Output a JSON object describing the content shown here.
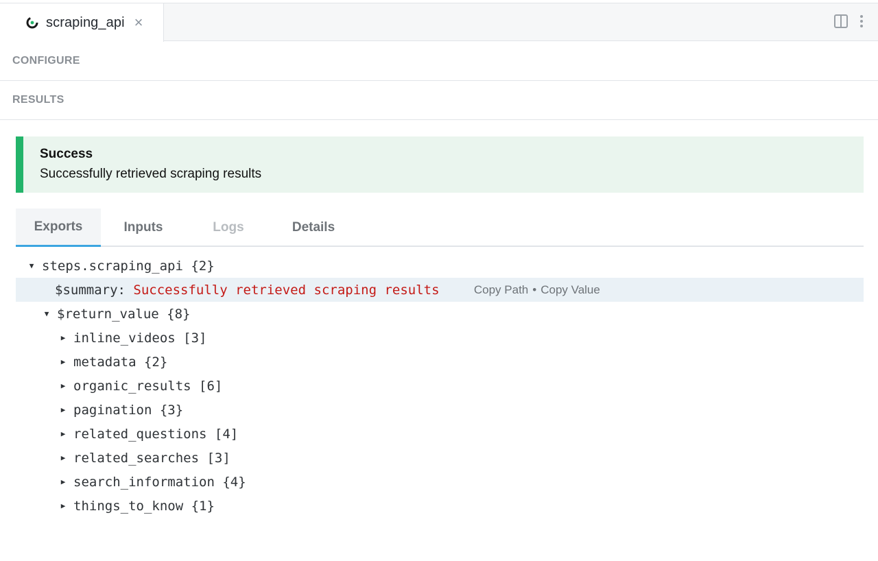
{
  "tab": {
    "title": "scraping_api",
    "close": "×"
  },
  "sections": {
    "configure": "CONFIGURE",
    "results": "RESULTS"
  },
  "alert": {
    "title": "Success",
    "message": "Successfully retrieved scraping results",
    "accent": "#23b46a"
  },
  "inner_tabs": [
    {
      "label": "Exports",
      "state": "active"
    },
    {
      "label": "Inputs",
      "state": "normal"
    },
    {
      "label": "Logs",
      "state": "disabled"
    },
    {
      "label": "Details",
      "state": "normal"
    }
  ],
  "tree": {
    "root": {
      "label": "steps.scraping_api",
      "count": "{2}"
    },
    "summary": {
      "key": "$summary:",
      "value": "Successfully retrieved scraping results",
      "copy_path": "Copy Path",
      "separator": "•",
      "copy_value": "Copy Value"
    },
    "return_value": {
      "label": "$return_value",
      "count": "{8}"
    },
    "children": [
      {
        "label": "inline_videos",
        "count": "[3]"
      },
      {
        "label": "metadata",
        "count": "{2}"
      },
      {
        "label": "organic_results",
        "count": "[6]"
      },
      {
        "label": "pagination",
        "count": "{3}"
      },
      {
        "label": "related_questions",
        "count": "[4]"
      },
      {
        "label": "related_searches",
        "count": "[3]"
      },
      {
        "label": "search_information",
        "count": "{4}"
      },
      {
        "label": "things_to_know",
        "count": "{1}"
      }
    ]
  },
  "colors": {
    "string_value": "#c41a16",
    "active_tab_underline": "#3ba5e0",
    "highlight_row": "#eaf1f6"
  }
}
